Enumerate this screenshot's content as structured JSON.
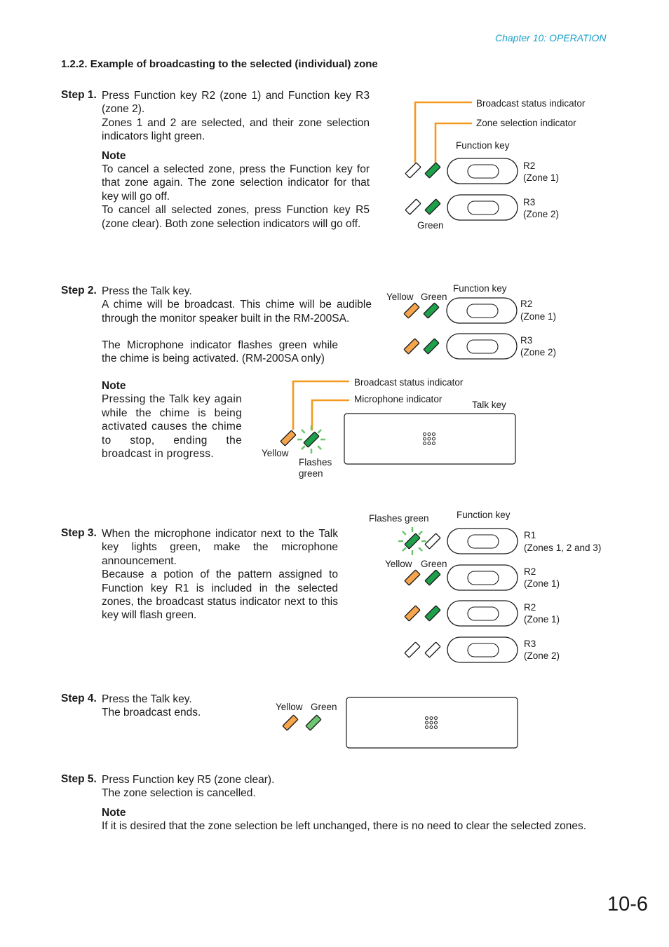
{
  "header": {
    "chapter": "Chapter 10: OPERATION"
  },
  "section_title": "1.2.2. Example of broadcasting to the selected (individual) zone",
  "colors": {
    "accent": "#1a9fc9",
    "callout_line": "#f39a1e",
    "indicator_green": "#1fa04a",
    "indicator_green_light": "#6cc66f",
    "indicator_yellow": "#f7a54b",
    "flash_rays": "#6cc66f"
  },
  "steps": [
    {
      "label": "Step 1.",
      "lines": [
        "Press Function key R2 (zone 1) and Function key R3 (zone 2).",
        "Zones 1 and 2 are selected, and their zone selection indicators light green."
      ],
      "note_title": "Note",
      "note_lines": [
        "To cancel a selected zone, press the Function key for that zone again. The zone selection indicator for that key will go off.",
        "To cancel all selected zones, press Function key R5 (zone clear). Both zone selection indicators will go off."
      ],
      "diagram": {
        "callout_broadcast": "Broadcast status indicator",
        "callout_zone": "Zone selection indicator",
        "function_key": "Function key",
        "keys": [
          {
            "name": "R2",
            "zone": "(Zone 1)"
          },
          {
            "name": "R3",
            "zone": "(Zone 2)"
          }
        ],
        "caption_green": "Green"
      }
    },
    {
      "label": "Step 2.",
      "lines": [
        "Press the Talk key.",
        "A chime will be broadcast. This chime will be audible through the monitor speaker built in the RM-200SA."
      ],
      "extra": "The Microphone indicator flashes green while the chime is being activated. (RM-200SA only)",
      "note_title": "Note",
      "note_text": "Pressing the Talk key again while the chime is being activated causes the chime to stop, ending the broadcast in progress.",
      "diagram": {
        "label_yellow": "Yellow",
        "label_green": "Green",
        "function_key": "Function key",
        "keys": [
          {
            "name": "R2",
            "zone": "(Zone 1)"
          },
          {
            "name": "R3",
            "zone": "(Zone 2)"
          }
        ],
        "callout_broadcast": "Broadcast status indicator",
        "callout_mic": "Microphone indicator",
        "talk_key": "Talk key",
        "caption_yellow": "Yellow",
        "caption_flash_1": "Flashes",
        "caption_flash_2": "green"
      }
    },
    {
      "label": "Step 3.",
      "text": "When the microphone indicator next to the Talk key lights green, make the microphone announcement. Because a potion of the pattern assigned to Function key R1 is included in the selected zones, the broadcast status indicator next to this key will flash green.",
      "lines": [
        "When the microphone indicator next to the Talk key lights green, make the microphone announcement.",
        "Because a potion of the pattern assigned to Function key R1 is included in the selected zones, the broadcast status indicator next to this key will flash green."
      ],
      "diagram": {
        "flashes_green": "Flashes green",
        "function_key": "Function key",
        "label_yellow": "Yellow",
        "label_green": "Green",
        "keys": [
          {
            "name": "R1",
            "zone": "(Zones 1, 2 and 3)"
          },
          {
            "name": "R2",
            "zone": "(Zone 1)"
          },
          {
            "name": "R2",
            "zone": "(Zone 1)"
          },
          {
            "name": "R3",
            "zone": "(Zone 2)"
          }
        ]
      }
    },
    {
      "label": "Step 4.",
      "lines": [
        "Press the Talk key.",
        "The broadcast ends."
      ],
      "diagram": {
        "label_yellow": "Yellow",
        "label_green": "Green"
      }
    },
    {
      "label": "Step 5.",
      "lines": [
        "Press Function key R5 (zone clear).",
        "The zone selection is cancelled."
      ],
      "note_title": "Note",
      "note_text": "If it is desired that the zone selection be left unchanged, there is no need to clear the selected zones."
    }
  ],
  "page_number": "10-6"
}
